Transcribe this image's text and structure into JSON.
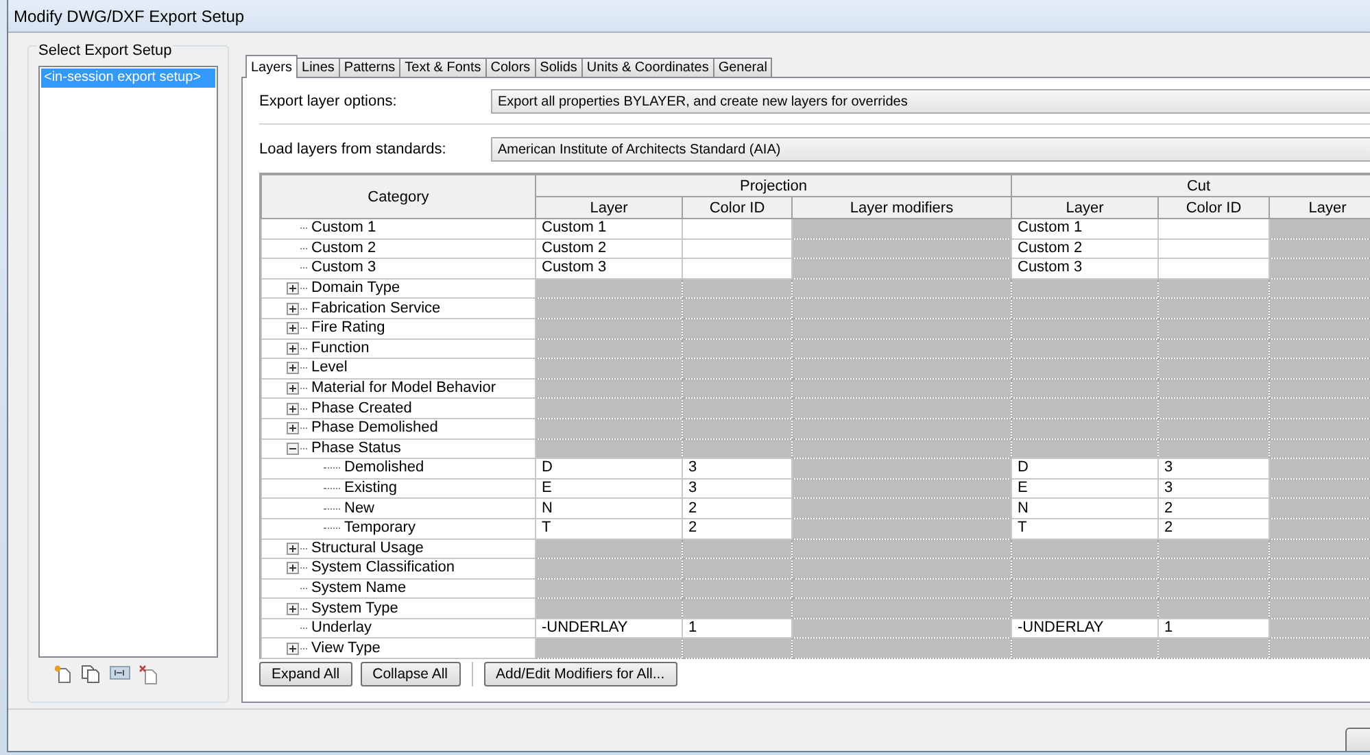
{
  "window": {
    "title": "Modify DWG/DXF Export Setup"
  },
  "export_setups": {
    "label": "Select Export Setup",
    "items": [
      {
        "label": "<in-session export setup>",
        "selected": true
      }
    ]
  },
  "tabs": [
    {
      "label": "Layers",
      "selected": true
    },
    {
      "label": "Lines",
      "selected": false
    },
    {
      "label": "Patterns",
      "selected": false
    },
    {
      "label": "Text & Fonts",
      "selected": false
    },
    {
      "label": "Colors",
      "selected": false
    },
    {
      "label": "Solids",
      "selected": false
    },
    {
      "label": "Units & Coordinates",
      "selected": false
    },
    {
      "label": "General",
      "selected": false
    }
  ],
  "export_layer_options": {
    "label": "Export layer options:",
    "value": "Export all properties BYLAYER, and create new layers for overrides"
  },
  "load_layers": {
    "label": "Load layers from standards:",
    "value": "American Institute of Architects Standard (AIA)"
  },
  "table": {
    "category_header": "Category",
    "groups": [
      {
        "label": "Projection",
        "columns": [
          "Layer",
          "Color ID",
          "Layer modifiers"
        ]
      },
      {
        "label": "Cut",
        "columns": [
          "Layer",
          "Color ID",
          "Layer"
        ]
      }
    ],
    "rows": [
      {
        "category": "Custom 1",
        "editable": true,
        "projection_layer": "Custom 1",
        "cut_layer": "Custom 1"
      },
      {
        "category": "Custom 2",
        "editable": true,
        "projection_layer": "Custom 2",
        "cut_layer": "Custom 2"
      },
      {
        "category": "Custom 3",
        "editable": true,
        "projection_layer": "Custom 3",
        "cut_layer": "Custom 3"
      },
      {
        "category": "Domain Type",
        "editable": false,
        "expanded": false
      },
      {
        "category": "Fabrication Service",
        "editable": false,
        "expanded": false
      },
      {
        "category": "Fire Rating",
        "editable": false,
        "expanded": false
      },
      {
        "category": "Function",
        "editable": false,
        "expanded": false
      },
      {
        "category": "Level",
        "editable": false,
        "expanded": false
      },
      {
        "category": "Material for Model Behavior",
        "editable": false,
        "expanded": false
      },
      {
        "category": "Phase Created",
        "editable": false,
        "expanded": false
      },
      {
        "category": "Phase Demolished",
        "editable": false,
        "expanded": false
      },
      {
        "category": "Phase Status",
        "editable": false,
        "expanded": true,
        "children": [
          {
            "category": "Demolished",
            "editable": true,
            "projection_layer": "D",
            "projection_color_id": "3",
            "cut_layer": "D",
            "cut_color_id": "3"
          },
          {
            "category": "Existing",
            "editable": true,
            "projection_layer": "E",
            "projection_color_id": "3",
            "cut_layer": "E",
            "cut_color_id": "3"
          },
          {
            "category": "New",
            "editable": true,
            "projection_layer": "N",
            "projection_color_id": "2",
            "cut_layer": "N",
            "cut_color_id": "2"
          },
          {
            "category": "Temporary",
            "editable": true,
            "projection_layer": "T",
            "projection_color_id": "2",
            "cut_layer": "T",
            "cut_color_id": "2"
          }
        ]
      },
      {
        "category": "Structural Usage",
        "editable": false,
        "expanded": false
      },
      {
        "category": "System Classification",
        "editable": false,
        "expanded": false
      },
      {
        "category": "System Name",
        "editable": false
      },
      {
        "category": "System Type",
        "editable": false,
        "expanded": false
      },
      {
        "category": "Underlay",
        "editable": true,
        "projection_layer": "-UNDERLAY",
        "projection_color_id": "1",
        "cut_layer": "-UNDERLAY",
        "cut_color_id": "1"
      },
      {
        "category": "View Type",
        "editable": false,
        "expanded": false
      }
    ]
  },
  "table_buttons": [
    "Expand All",
    "Collapse All",
    "Add/Edit Modifiers for All..."
  ]
}
